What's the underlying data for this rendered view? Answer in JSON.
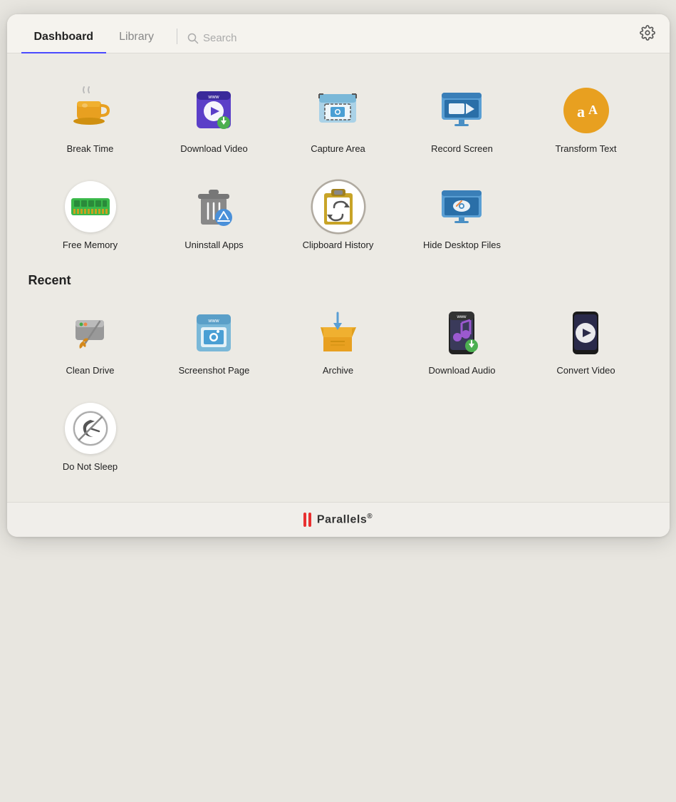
{
  "header": {
    "tabs": [
      {
        "id": "dashboard",
        "label": "Dashboard",
        "active": true
      },
      {
        "id": "library",
        "label": "Library",
        "active": false
      }
    ],
    "search_placeholder": "Search",
    "gear_label": "Settings"
  },
  "tools": [
    {
      "id": "break-time",
      "label": "Break Time"
    },
    {
      "id": "download-video",
      "label": "Download Video"
    },
    {
      "id": "capture-area",
      "label": "Capture Area"
    },
    {
      "id": "record-screen",
      "label": "Record Screen"
    },
    {
      "id": "transform-text",
      "label": "Transform Text"
    },
    {
      "id": "free-memory",
      "label": "Free Memory"
    },
    {
      "id": "uninstall-apps",
      "label": "Uninstall Apps"
    },
    {
      "id": "clipboard-history",
      "label": "Clipboard History"
    },
    {
      "id": "hide-desktop-files",
      "label": "Hide Desktop Files"
    }
  ],
  "recent": {
    "label": "Recent",
    "items": [
      {
        "id": "clean-drive",
        "label": "Clean Drive"
      },
      {
        "id": "screenshot-page",
        "label": "Screenshot Page"
      },
      {
        "id": "archive",
        "label": "Archive"
      },
      {
        "id": "download-audio",
        "label": "Download Audio"
      },
      {
        "id": "convert-video",
        "label": "Convert Video"
      },
      {
        "id": "do-not-sleep",
        "label": "Do Not Sleep"
      }
    ]
  },
  "footer": {
    "brand": "Parallels",
    "registered": "®"
  }
}
